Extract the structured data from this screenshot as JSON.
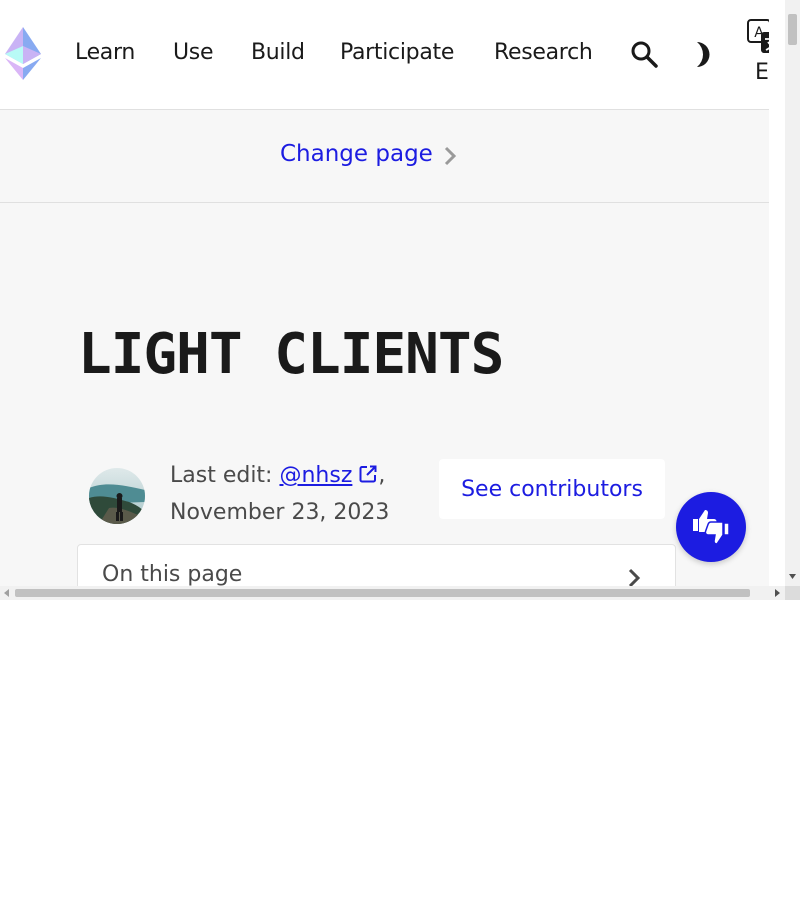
{
  "nav": {
    "links": [
      "Learn",
      "Use",
      "Build",
      "Participate",
      "Research"
    ],
    "language": "EN",
    "icons": {
      "logo": "ethereum-logo",
      "search": "search-icon",
      "theme": "dark-mode-toggle-icon",
      "translate": "translate-icon"
    }
  },
  "change_page": {
    "label": "Change page"
  },
  "page": {
    "title": "LIGHT CLIENTS"
  },
  "meta": {
    "last_edit_prefix": "Last edit: ",
    "author": "@nhsz",
    "comma": ",",
    "date": "November 23, 2023",
    "contributors_button": "See contributors"
  },
  "toc": {
    "label": "On this page"
  },
  "colors": {
    "link": "#1c1ce1",
    "background": "#f7f7f7",
    "text": "#1a1a1a",
    "muted_text": "#4a4a4a",
    "feedback_button": "#1c1ce1"
  }
}
